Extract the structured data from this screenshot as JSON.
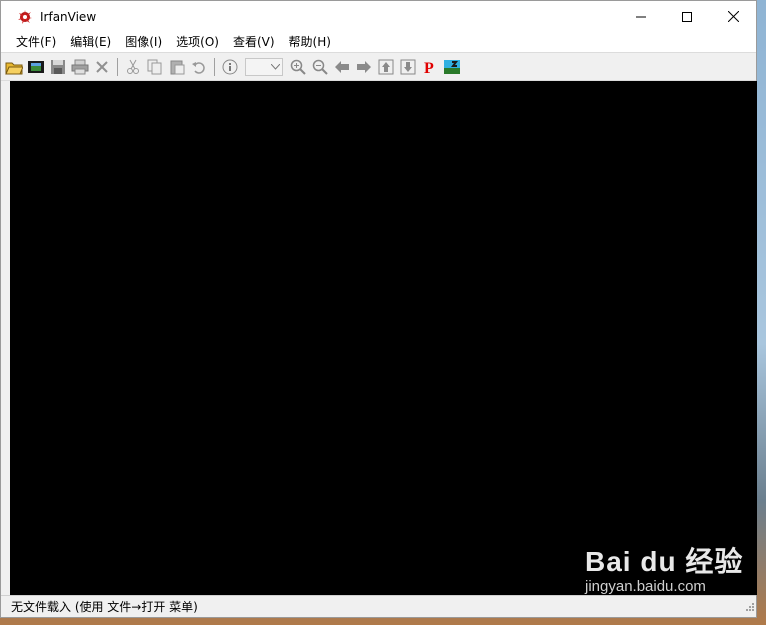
{
  "window": {
    "title": "IrfanView"
  },
  "menu": [
    "文件(F)",
    "编辑(E)",
    "图像(I)",
    "选项(O)",
    "查看(V)",
    "帮助(H)"
  ],
  "toolbar": {
    "icons": [
      "open-folder-icon",
      "slideshow-icon",
      "save-icon",
      "print-icon",
      "delete-icon",
      "cut-icon",
      "copy-icon",
      "paste-icon",
      "undo-icon",
      "info-icon",
      "zoom-select",
      "zoom-in-icon",
      "zoom-out-icon",
      "previous-icon",
      "next-icon",
      "first-icon",
      "last-icon",
      "paint-icon",
      "thumbnails-icon"
    ],
    "zoom_value": ""
  },
  "status": {
    "text": "无文件载入 (使用 文件→打开 菜单)"
  },
  "watermark": {
    "brand": "Bai du 经验",
    "sub": "jingyan.baidu.com"
  },
  "colors": {
    "image_bg": "#000000",
    "paint_p": "#e00000"
  }
}
